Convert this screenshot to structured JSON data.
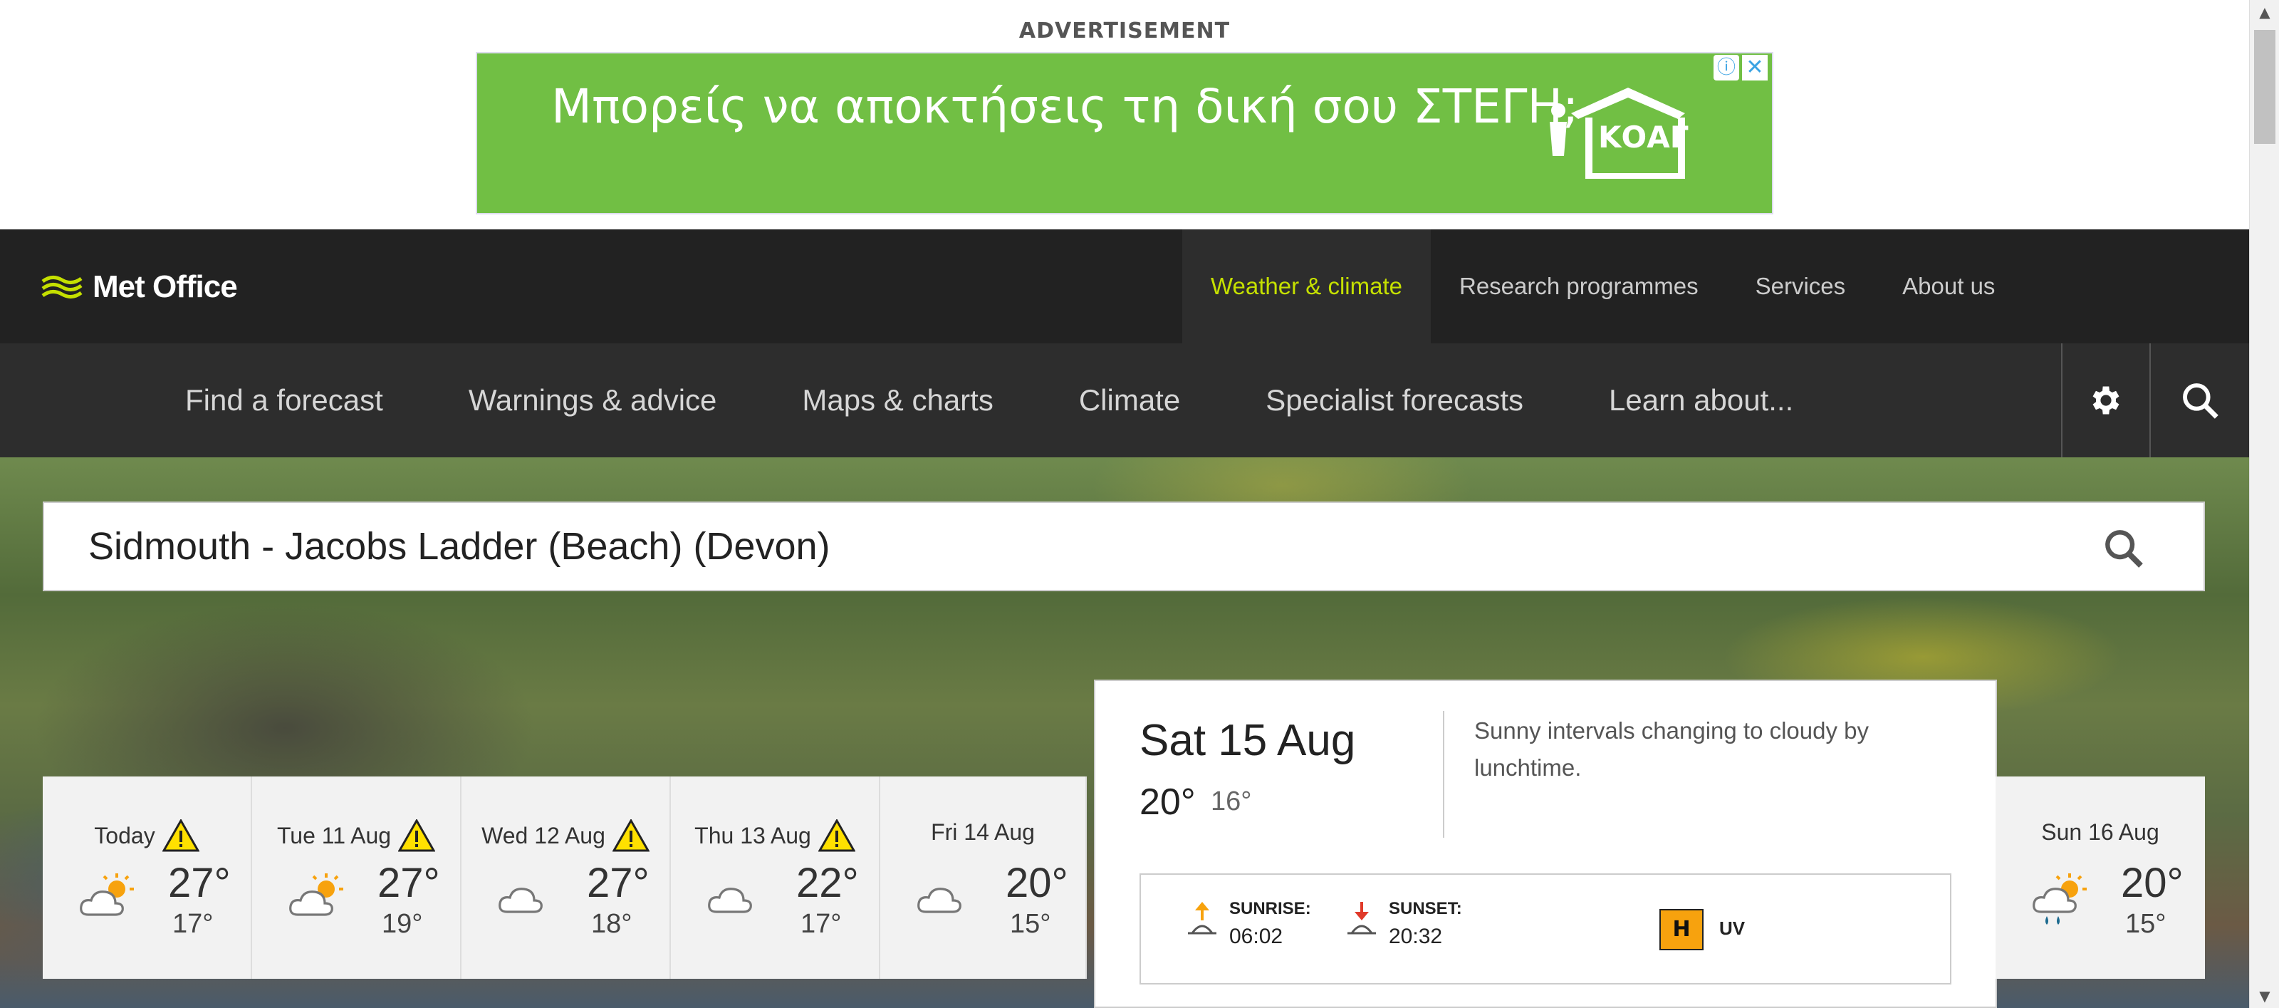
{
  "ad": {
    "label": "ADVERTISEMENT",
    "text": "Μπορείς να αποκτήσεις τη δική σου ΣΤΕΓΗ;",
    "logo_text": "ΚΟΑΓ",
    "bg_color": "#71bf44"
  },
  "header": {
    "brand": "Met Office",
    "top_links": [
      {
        "label": "Weather & climate",
        "active": true
      },
      {
        "label": "Research programmes"
      },
      {
        "label": "Services"
      },
      {
        "label": "About us"
      }
    ],
    "sub_links": [
      {
        "label": "Find a forecast"
      },
      {
        "label": "Warnings & advice"
      },
      {
        "label": "Maps & charts"
      },
      {
        "label": "Climate"
      },
      {
        "label": "Specialist forecasts"
      },
      {
        "label": "Learn about..."
      }
    ]
  },
  "search": {
    "value": "Sidmouth - Jacobs Ladder (Beach) (Devon)"
  },
  "forecast": {
    "days": [
      {
        "label": "Today",
        "warning": true,
        "high": "27°",
        "low": "17°",
        "icon": "sunny-intervals-icon"
      },
      {
        "label": "Tue 11 Aug",
        "warning": true,
        "high": "27°",
        "low": "19°",
        "icon": "sunny-intervals-icon"
      },
      {
        "label": "Wed 12 Aug",
        "warning": true,
        "high": "27°",
        "low": "18°",
        "icon": "cloudy-icon"
      },
      {
        "label": "Thu 13 Aug",
        "warning": true,
        "high": "22°",
        "low": "17°",
        "icon": "cloudy-icon"
      },
      {
        "label": "Fri 14 Aug",
        "warning": false,
        "high": "20°",
        "low": "15°",
        "icon": "cloudy-icon"
      }
    ],
    "selected": {
      "title": "Sat 15 Aug",
      "high": "20°",
      "low": "16°",
      "summary": "Sunny intervals changing to cloudy by lunchtime.",
      "sunrise_label": "SUNRISE:",
      "sunrise": "06:02",
      "sunset_label": "SUNSET:",
      "sunset": "20:32",
      "uv_value": "H",
      "uv_label": "UV"
    },
    "last": {
      "label": "Sun 16 Aug",
      "high": "20°",
      "low": "15°",
      "icon": "sun-shower-icon"
    }
  },
  "colors": {
    "accent": "#c5e000",
    "nav_dark": "#222222",
    "nav_mid": "#2d2d2d",
    "uv_high": "#f7a20e",
    "warning": "#ffe000"
  }
}
